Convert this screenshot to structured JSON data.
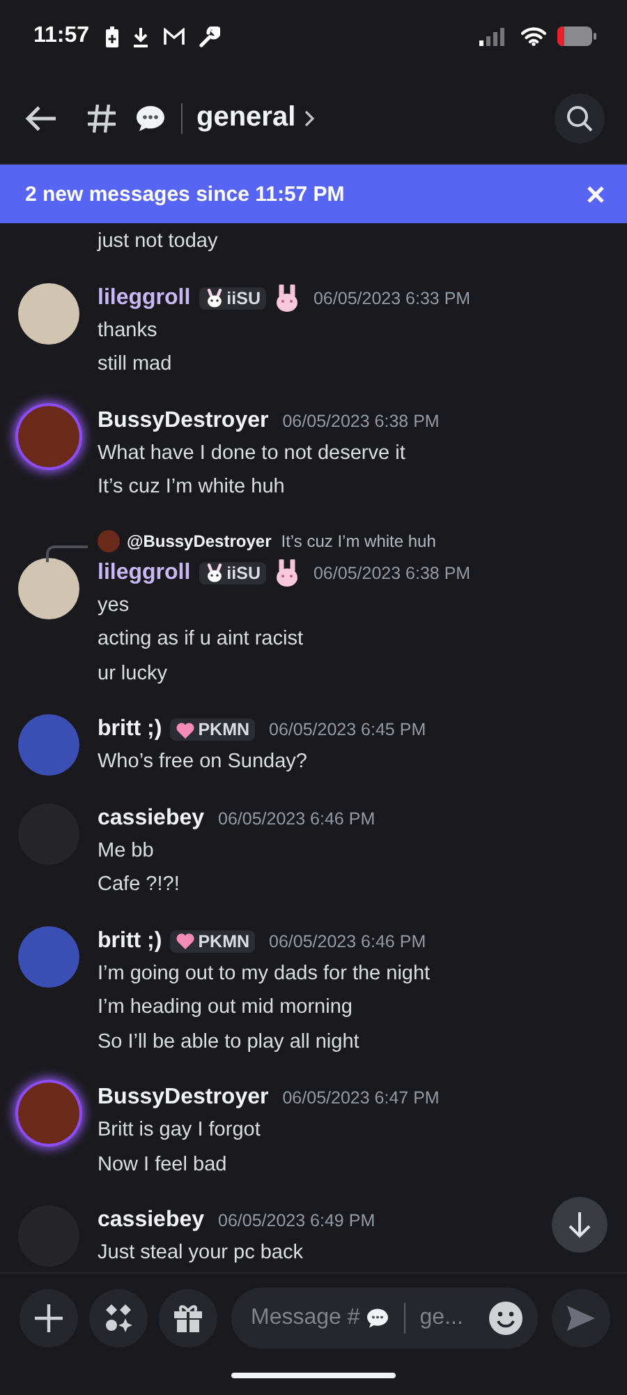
{
  "status_bar": {
    "time": "11:57"
  },
  "header": {
    "channel": "general"
  },
  "banner": {
    "text": "2 new messages since 11:57 PM"
  },
  "continuation": [
    "just not today"
  ],
  "messages": [
    {
      "author": "lileggroll",
      "color": "#c6b9f6",
      "avatar": {
        "color": "#cfc5b0"
      },
      "glow": false,
      "tag": {
        "kind": "bunny",
        "label": "iiSU"
      },
      "emoji_badge": true,
      "time": "06/05/2023 6:33 PM",
      "lines": [
        "thanks",
        "still mad"
      ]
    },
    {
      "author": "BussyDestroyer",
      "color": "#f2f3f5",
      "avatar": {
        "color": "#6b2a1a"
      },
      "glow": true,
      "time": "06/05/2023 6:38 PM",
      "lines": [
        "What have I done to not deserve it",
        "It’s cuz I’m white huh"
      ]
    },
    {
      "author": "lileggroll",
      "color": "#c6b9f6",
      "avatar": {
        "color": "#cfc5b0"
      },
      "glow": false,
      "reply": {
        "author": "@BussyDestroyer",
        "text": "It’s cuz I’m white huh"
      },
      "tag": {
        "kind": "bunny",
        "label": "iiSU"
      },
      "emoji_badge": true,
      "time": "06/05/2023 6:38 PM",
      "lines": [
        "yes",
        "acting as if u aint racist",
        "ur lucky"
      ]
    },
    {
      "author": "britt ;)",
      "color": "#f2f3f5",
      "avatar": {
        "color": "#3b4fb5"
      },
      "glow": false,
      "tag": {
        "kind": "heart",
        "label": "PKMN"
      },
      "emoji_badge": false,
      "time": "06/05/2023 6:45 PM",
      "lines": [
        "Who’s free on Sunday?"
      ]
    },
    {
      "author": "cassiebey",
      "color": "#f2f3f5",
      "avatar": {
        "color": "#26262a"
      },
      "glow": false,
      "time": "06/05/2023 6:46 PM",
      "lines": [
        "Me bb",
        "Cafe ?!?!"
      ]
    },
    {
      "author": "britt ;)",
      "color": "#f2f3f5",
      "avatar": {
        "color": "#3b4fb5"
      },
      "glow": false,
      "tag": {
        "kind": "heart",
        "label": "PKMN"
      },
      "emoji_badge": false,
      "time": "06/05/2023 6:46 PM",
      "lines": [
        "I’m going out to my dads for the night",
        "I’m heading out mid morning",
        "So I’ll be able to play all night"
      ]
    },
    {
      "author": "BussyDestroyer",
      "color": "#f2f3f5",
      "avatar": {
        "color": "#6b2a1a"
      },
      "glow": true,
      "time": "06/05/2023 6:47 PM",
      "lines": [
        "Britt is gay I forgot",
        "Now I feel bad"
      ]
    },
    {
      "author": "cassiebey",
      "color": "#f2f3f5",
      "avatar": {
        "color": "#26262a"
      },
      "glow": false,
      "time": "06/05/2023 6:49 PM",
      "lines": [
        "Just steal your pc back"
      ]
    }
  ],
  "composer": {
    "placeholder_prefix": "Message #",
    "placeholder_channel": "ge..."
  }
}
